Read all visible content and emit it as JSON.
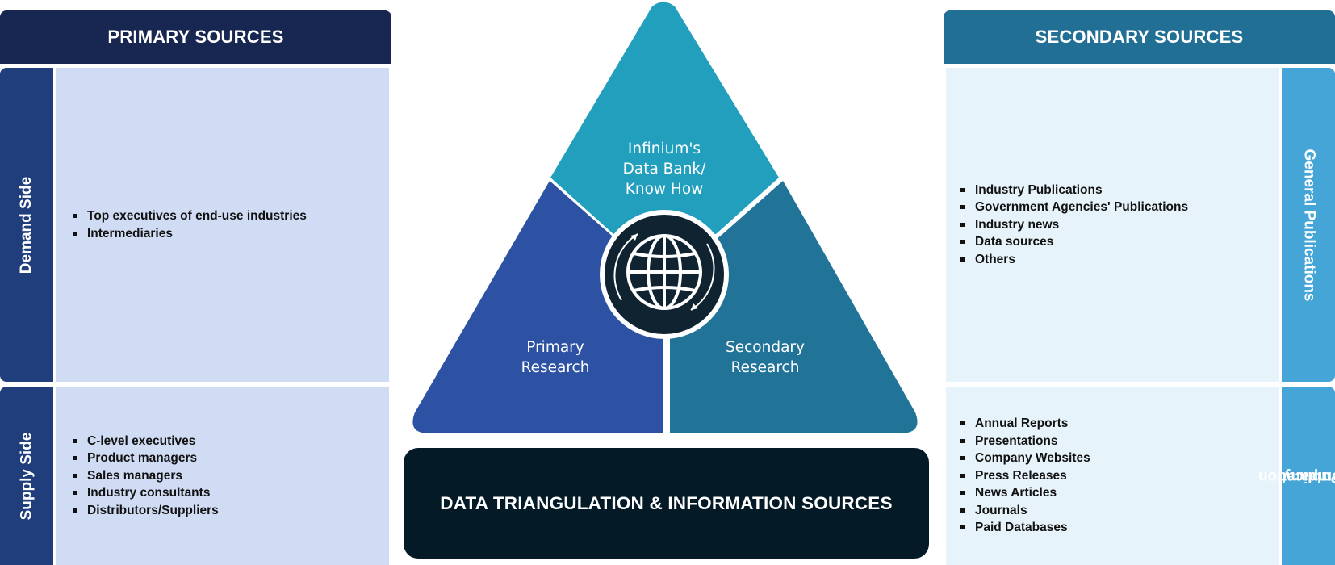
{
  "primary": {
    "title": "PRIMARY SOURCES",
    "demand_label": "Demand Side",
    "demand_items": [
      "Top executives of end-use industries",
      "Intermediaries"
    ],
    "supply_label": "Supply Side",
    "supply_items": [
      "C-level executives",
      "Product managers",
      "Sales managers",
      "Industry consultants",
      "Distributors/Suppliers"
    ]
  },
  "secondary": {
    "title": "SECONDARY SOURCES",
    "general_label": "General Publications",
    "general_items": [
      "Industry Publications",
      "Government Agencies' Publications",
      "Industry news",
      "Data sources",
      "Others"
    ],
    "company_label": [
      "Company",
      "Publication"
    ],
    "company_items": [
      "Annual Reports",
      "Presentations",
      "Company Websites",
      "Press Releases",
      "News Articles",
      "Journals",
      "Paid Databases"
    ]
  },
  "triangle": {
    "top_label": [
      "Infinium's",
      "Data Bank/",
      "Know How"
    ],
    "left_label": [
      "Primary",
      "Research"
    ],
    "right_label": [
      "Secondary",
      "Research"
    ],
    "center_icon": "globe-icon"
  },
  "footer": {
    "title": "DATA TRIANGULATION & INFORMATION SOURCES"
  },
  "colors": {
    "primary_header": "#172751",
    "primary_side": "#203e7c",
    "primary_panel": "#d0dcf4",
    "secondary_header": "#226f95",
    "secondary_side": "#45a5d6",
    "secondary_panel": "#e7f3fa",
    "triangle_top": "#219fbd",
    "triangle_left": "#2d52a3",
    "triangle_right": "#227398",
    "center_circle": "#0f2331",
    "footer_box": "#041b27"
  }
}
